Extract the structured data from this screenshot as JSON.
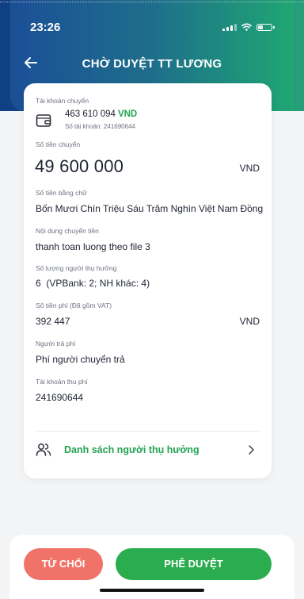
{
  "status_bar": {
    "time": "23:26"
  },
  "header": {
    "title": "CHỜ DUYỆT TT LƯƠNG"
  },
  "source_account": {
    "label": "Tài khoản chuyển",
    "balance": "463 610 094",
    "currency": "VND",
    "account_number": "Số tài khoản: 241690644"
  },
  "amount": {
    "label": "Số tiền chuyển",
    "value": "49 600 000",
    "unit": "VND"
  },
  "amount_words": {
    "label": "Số tiền bằng chữ",
    "value": "Bốn Mươi Chín Triệu Sáu Trăm Nghìn Việt Nam Đồng"
  },
  "content": {
    "label": "Nội dung chuyển tiền",
    "value": "thanh toan luong theo file 3"
  },
  "beneficiaries": {
    "label": "Số lượng người thụ hưởng",
    "value": "6  (VPBank: 2; NH khác: 4)"
  },
  "fee": {
    "label": "Số tiền phí (Đã gồm VAT)",
    "value": "392 447",
    "unit": "VND"
  },
  "fee_payer": {
    "label": "Người trả phí",
    "value": "Phí người chuyển trả"
  },
  "fee_account": {
    "label": "Tài khoản thu phí",
    "value": "241690644"
  },
  "beneficiary_list": {
    "label": "Danh sách người thụ hưởng"
  },
  "actions": {
    "reject": "TỪ CHỐI",
    "approve": "PHÊ DUYỆT"
  },
  "colors": {
    "accent_green": "#22a352",
    "reject_red": "#f07269",
    "header_blue": "#1b4f97"
  },
  "icons": [
    "back-arrow-icon",
    "wallet-icon",
    "users-icon",
    "chevron-right-icon"
  ]
}
